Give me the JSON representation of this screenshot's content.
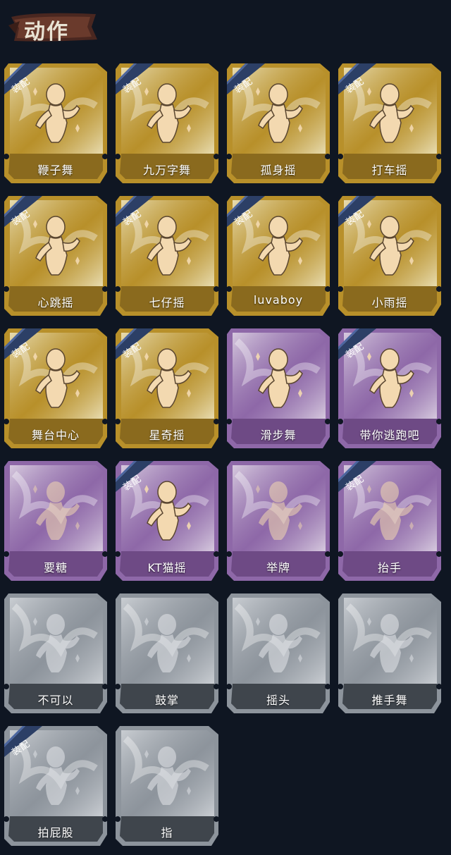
{
  "header": {
    "title": "动作"
  },
  "badge_text": "装配",
  "tier_colors": {
    "gold": {
      "outer": "#b8902a",
      "inner": "#e8dcb0",
      "band": "#8a6a1e",
      "fig": "#f3d9b0"
    },
    "purple": {
      "outer": "#8e68a8",
      "inner": "#d6c9de",
      "band": "#6e4a85",
      "fig": "#f3d9b0"
    },
    "white": {
      "outer": "#8d949c",
      "inner": "#c9cdd2",
      "band": "#3f454c",
      "fig": "#e4e6ea"
    }
  },
  "actions": [
    {
      "label": "鞭子舞",
      "tier": "gold",
      "equipped": true,
      "unlocked": true
    },
    {
      "label": "九万字舞",
      "tier": "gold",
      "equipped": true,
      "unlocked": true
    },
    {
      "label": "孤身摇",
      "tier": "gold",
      "equipped": true,
      "unlocked": true
    },
    {
      "label": "打车摇",
      "tier": "gold",
      "equipped": true,
      "unlocked": true
    },
    {
      "label": "心跳摇",
      "tier": "gold",
      "equipped": true,
      "unlocked": true
    },
    {
      "label": "七仔摇",
      "tier": "gold",
      "equipped": true,
      "unlocked": true
    },
    {
      "label": "luvaboy",
      "tier": "gold",
      "equipped": true,
      "unlocked": true
    },
    {
      "label": "小雨摇",
      "tier": "gold",
      "equipped": true,
      "unlocked": true
    },
    {
      "label": "舞台中心",
      "tier": "gold",
      "equipped": true,
      "unlocked": true
    },
    {
      "label": "星奇摇",
      "tier": "gold",
      "equipped": true,
      "unlocked": true
    },
    {
      "label": "滑步舞",
      "tier": "purple",
      "equipped": false,
      "unlocked": true
    },
    {
      "label": "带你逃跑吧",
      "tier": "purple",
      "equipped": true,
      "unlocked": true
    },
    {
      "label": "要糖",
      "tier": "purple",
      "equipped": false,
      "unlocked": false
    },
    {
      "label": "KT猫摇",
      "tier": "purple",
      "equipped": true,
      "unlocked": true
    },
    {
      "label": "举牌",
      "tier": "purple",
      "equipped": false,
      "unlocked": false
    },
    {
      "label": "抬手",
      "tier": "purple",
      "equipped": true,
      "unlocked": false
    },
    {
      "label": "不可以",
      "tier": "white",
      "equipped": false,
      "unlocked": false
    },
    {
      "label": "鼓掌",
      "tier": "white",
      "equipped": false,
      "unlocked": false
    },
    {
      "label": "摇头",
      "tier": "white",
      "equipped": false,
      "unlocked": false
    },
    {
      "label": "推手舞",
      "tier": "white",
      "equipped": false,
      "unlocked": false
    },
    {
      "label": "拍屁股",
      "tier": "white",
      "equipped": true,
      "unlocked": false
    },
    {
      "label": "指",
      "tier": "white",
      "equipped": false,
      "unlocked": false
    }
  ]
}
